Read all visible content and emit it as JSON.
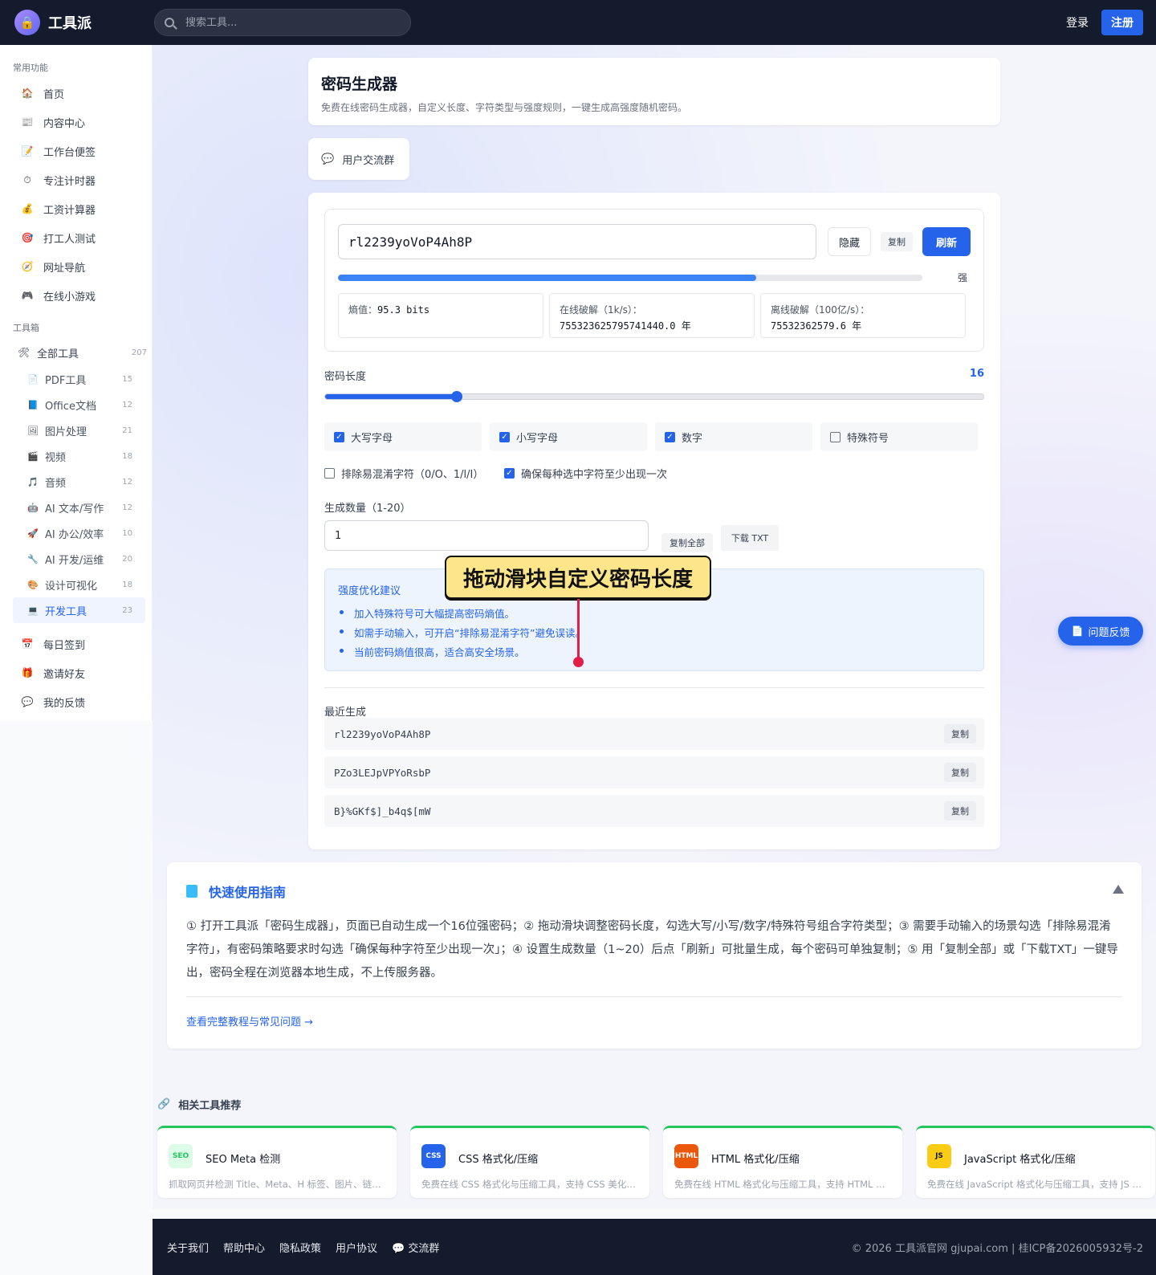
{
  "app": {
    "name": "工具派",
    "logo_icon": "lock-icon"
  },
  "header": {
    "search_placeholder": "搜索工具...",
    "login": "登录",
    "register": "注册"
  },
  "sidebar": {
    "section_common": "常用功能",
    "common": [
      {
        "icon": "🏠",
        "label": "首页"
      },
      {
        "icon": "📰",
        "label": "内容中心"
      },
      {
        "icon": "📝",
        "label": "工作台便签"
      },
      {
        "icon": "⏱",
        "label": "专注计时器"
      },
      {
        "icon": "💰",
        "label": "工资计算器"
      },
      {
        "icon": "🎯",
        "label": "打工人测试"
      },
      {
        "icon": "🧭",
        "label": "网址导航"
      },
      {
        "icon": "🎮",
        "label": "在线小游戏"
      }
    ],
    "section_tools": "工具箱",
    "all_tools": {
      "icon": "🛠",
      "label": "全部工具",
      "count": "207"
    },
    "categories": [
      {
        "icon": "📄",
        "label": "PDF工具",
        "count": "15"
      },
      {
        "icon": "📘",
        "label": "Office文档",
        "count": "12"
      },
      {
        "icon": "🖼",
        "label": "图片处理",
        "count": "21"
      },
      {
        "icon": "🎬",
        "label": "视频",
        "count": "18"
      },
      {
        "icon": "🎵",
        "label": "音频",
        "count": "12"
      },
      {
        "icon": "🤖",
        "label": "AI 文本/写作",
        "count": "12"
      },
      {
        "icon": "🚀",
        "label": "AI 办公/效率",
        "count": "10"
      },
      {
        "icon": "🔧",
        "label": "AI 开发/运维",
        "count": "20"
      },
      {
        "icon": "🎨",
        "label": "设计可视化",
        "count": "18"
      },
      {
        "icon": "💻",
        "label": "开发工具",
        "count": "23"
      }
    ],
    "bottom": [
      {
        "icon": "📅",
        "label": "每日签到"
      },
      {
        "icon": "🎁",
        "label": "邀请好友"
      },
      {
        "icon": "💬",
        "label": "我的反馈"
      }
    ]
  },
  "page": {
    "title": "密码生成器",
    "subtitle": "免费在线密码生成器，自定义长度、字符类型与强度规则，一键生成高强度随机密码。",
    "group_button": "用户交流群"
  },
  "generator": {
    "password": "rl2239yoVoP4Ah8P",
    "hide": "隐藏",
    "copy": "复制",
    "refresh": "刷新",
    "strength_label": "强",
    "strength_fraction": 0.715,
    "entropy_label": "熵值：",
    "entropy_value": "95.3 bits",
    "online_label": "在线破解（1k/s）：",
    "online_value": "755323625795741440.0 年",
    "offline_label": "离线破解（100亿/s）：",
    "offline_value": "75532362579.6 年"
  },
  "length": {
    "label": "密码长度",
    "value": "16",
    "min": 4,
    "max": 64,
    "current": 16
  },
  "options": [
    {
      "label": "大写字母",
      "checked": true
    },
    {
      "label": "小写字母",
      "checked": true
    },
    {
      "label": "数字",
      "checked": true
    },
    {
      "label": "特殊符号",
      "checked": false
    }
  ],
  "extra_options": [
    {
      "label": "排除易混淆字符（0/O、1/l/I）",
      "checked": false
    },
    {
      "label": "确保每种选中字符至少出现一次",
      "checked": true
    }
  ],
  "quantity": {
    "label": "生成数量（1-20）",
    "value": "1",
    "copy_all": "复制全部",
    "download": "下载 TXT"
  },
  "tips": {
    "title": "强度优化建议",
    "items": [
      "加入特殊符号可大幅提高密码熵值。",
      "如需手动输入，可开启“排除易混淆字符”避免误读。",
      "当前密码熵值很高，适合高安全场景。"
    ]
  },
  "callout": "拖动滑块自定义密码长度",
  "recent": {
    "title": "最近生成",
    "items": [
      "rl2239yoVoP4Ah8P",
      "PZo3LEJpVPYoRsbP",
      "B}%GKf$]_b4q$[mW"
    ],
    "copy": "复制"
  },
  "feedback": "问题反馈",
  "guide": {
    "title": "快速使用指南",
    "body": "① 打开工具派「密码生成器」，页面已自动生成一个16位强密码；② 拖动滑块调整密码长度，勾选大写/小写/数字/特殊符号组合字符类型；③ 需要手动输入的场景勾选「排除易混淆字符」，有密码策略要求时勾选「确保每种字符至少出现一次」；④ 设置生成数量（1~20）后点「刷新」可批量生成，每个密码可单独复制；⑤ 用「复制全部」或「下载TXT」一键导出，密码全程在浏览器本地生成，不上传服务器。",
    "link": "查看完整教程与常见问题 →"
  },
  "related": {
    "title": "相关工具推荐",
    "items": [
      {
        "badge": "SEO",
        "name": "SEO Meta 检测",
        "desc": "抓取网页并检测 Title、Meta、H 标签、图片、链接等",
        "color": "#22c55e",
        "bg": "#dcfce7"
      },
      {
        "badge": "CSS",
        "name": "CSS 格式化/压缩",
        "desc": "免费在线 CSS 格式化与压缩工具，支持 CSS 美化与压缩",
        "color": "#ffffff",
        "bg": "#2563eb"
      },
      {
        "badge": "HTML",
        "name": "HTML 格式化/压缩",
        "desc": "免费在线 HTML 格式化与压缩工具，支持 HTML 美化",
        "color": "#ffffff",
        "bg": "#ea580c"
      },
      {
        "badge": "JS",
        "name": "JavaScript 格式化/压缩",
        "desc": "免费在线 JavaScript 格式化与压缩工具，支持 JS 美化",
        "color": "#111827",
        "bg": "#facc15"
      }
    ]
  },
  "footer": {
    "links": [
      "关于我们",
      "帮助中心",
      "隐私政策",
      "用户协议",
      "💬 交流群"
    ],
    "copyright": "© 2026 工具派官网 gjupai.com | 桂ICP备2026005932号-2"
  }
}
